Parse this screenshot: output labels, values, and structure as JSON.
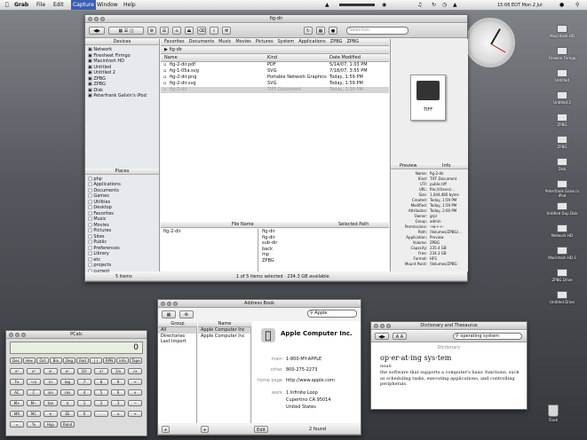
{
  "menubar": {
    "items": [
      "Grab",
      "File",
      "Edit",
      "Capture",
      "Window",
      "Help"
    ],
    "clock": "15:06 EDT Mon 2 Jul"
  },
  "finder": {
    "title": "fig-dir",
    "search_placeholder": "Selection",
    "path_bar": [
      "fig-dir"
    ],
    "tabs": [
      "Favorites",
      "Documents",
      "Music",
      "Movies",
      "Pictures",
      "System",
      "Applications",
      "ZPBG",
      "ZPBG"
    ],
    "status": "1 of 5 items selected  ·  234.3 GB available",
    "status_left": "5 items",
    "sidebar_header": "Devices",
    "devices": [
      "Network",
      "Firesheet Firmgo",
      "Macintosh HD",
      "Untitled",
      "Untitled 2",
      "ZPBG",
      "ZPBG",
      "Disk",
      "Peterfrank Galvin's iPod"
    ],
    "places_header": "Places",
    "places": [
      "php",
      "Applications",
      "Documents",
      "Games",
      "Utilities",
      "Desktop",
      "Favorites",
      "Music",
      "Movies",
      "Pictures",
      "Sites",
      "Public",
      "Preferences",
      "Library",
      "etc",
      "projects",
      "current"
    ],
    "columns": [
      "Name",
      "Kind",
      "Date Modified",
      "Size",
      "Application"
    ],
    "files": [
      {
        "name": "fig-2-dir.pdf",
        "kind": "PDF",
        "date": "5/14/07, 1:03 PM",
        "size": "396.1 kB",
        "app": "Skim"
      },
      {
        "name": "fig-1-05a.svg",
        "kind": "SVG",
        "date": "7/18/07, 3:55 PM",
        "size": "7.7 kB",
        "app": "Inkscape"
      },
      {
        "name": "fig-2-dir.png",
        "kind": "Portable Network Graphics Image",
        "date": "Today, 1:59 PM",
        "size": "19.2 kB",
        "app": "Preview"
      },
      {
        "name": "fig-2-dir.svg",
        "kind": "SVG",
        "date": "Today, 1:59 PM",
        "size": "12.2 kB",
        "app": "Inkscape"
      },
      {
        "name": "fig-2-dir",
        "kind": "TIFF Document",
        "date": "Today, 1:59 PM",
        "size": "1 MB",
        "app": "Preview"
      }
    ],
    "lower_header_left": "File Name",
    "lower_header_right": "Selected Path",
    "lower_left": [
      "fig-2-dir"
    ],
    "lower_right": [
      "fig-dir",
      "fig-dir",
      "sub-dir",
      "back",
      "mp",
      "ZPBG"
    ],
    "info_tabs": [
      "Preview",
      "Info"
    ],
    "tiff_label": "TIFF",
    "info": [
      [
        "Name:",
        "fig-2-dir"
      ],
      [
        "Kind:",
        "TIFF Document"
      ],
      [
        "UTI:",
        "public.tiff"
      ],
      [
        "URL:",
        "file:///Users/..."
      ],
      [
        "Size:",
        "1,044,480 bytes"
      ],
      [
        "Created:",
        "Today, 1:59 PM"
      ],
      [
        "Modified:",
        "Today, 1:59 PM"
      ],
      [
        "Attributes:",
        "Today, 2:00 PM"
      ],
      [
        "Owner:",
        "grpl"
      ],
      [
        "Group:",
        "admin"
      ],
      [
        "Permissions:",
        "-rw-r--r--"
      ],
      [
        "Path:",
        "/Volumes/ZPBG/..."
      ],
      [
        "Application:",
        "Preview"
      ],
      [
        "Volume:",
        "ZPBG"
      ],
      [
        "Capacity:",
        "235.4 GB"
      ],
      [
        "Free:",
        "234.3 GB"
      ],
      [
        "Format:",
        "HFS"
      ],
      [
        "Mount Point:",
        "/Volumes/ZPBG"
      ]
    ]
  },
  "desktop_icons": [
    "Macintosh HD",
    "Firewire Firmgo",
    "Untitled",
    "Untitled 2",
    "ZPBG",
    "ZPBG",
    "Disk",
    "Peterfrank Galvin's iPod",
    "Untitled Dup Disk",
    "Network HD",
    "Macintosh HD 2",
    "ZPBG Drive",
    "Untitled Drive"
  ],
  "trash_label": "Trash",
  "calculator": {
    "title": "PCalc",
    "display": "0",
    "row1": [
      "Dec",
      "Hex",
      "Oct",
      "Bin",
      "Deg",
      "Rad",
      "( )",
      "RPN",
      "Info",
      "Tape"
    ],
    "keys": [
      "x²",
      "x³",
      "xʸ",
      "eˣ",
      "10ˣ",
      "x!",
      "1/x",
      "√x",
      "∛x",
      "ʸ√x",
      "ln",
      "log",
      "7",
      "8",
      "9",
      "÷",
      "AC",
      "C",
      "sin",
      "cos",
      "4",
      "5",
      "6",
      "×",
      "M+",
      "M−",
      "tan",
      "π",
      "1",
      "2",
      "3",
      "−",
      "MR",
      "MC",
      "e",
      "EE",
      "0",
      ".",
      "±",
      "+",
      "=",
      "%",
      "Hyp",
      "Rand"
    ]
  },
  "address_book": {
    "title": "Address Book",
    "search_value": "Apple",
    "group_header": "Group",
    "name_header": "Name",
    "groups": [
      "All",
      "Directories",
      "Last Import"
    ],
    "names": [
      "Apple Computer Inc",
      "Apple Computer Inc"
    ],
    "company": "Apple Computer Inc.",
    "fields": [
      [
        "main",
        "1-800-MY-APPLE"
      ],
      [
        "other",
        "800-275-2273"
      ],
      [
        "home page",
        "http://www.apple.com"
      ],
      [
        "work",
        "1 Infinite Loop"
      ],
      [
        "",
        "Cupertino CA 95014"
      ],
      [
        "",
        "United States"
      ]
    ],
    "card_count": "2 found",
    "edit_label": "Edit"
  },
  "dictionary": {
    "title": "Dictionary and Thesaurus",
    "search_value": "operating system",
    "source": "Dictionary",
    "headword": "op·er·at·ing sys·tem",
    "pos": "noun",
    "definition": "the software that supports a computer's basic functions, such as scheduling tasks, executing applications, and controlling peripherals."
  }
}
